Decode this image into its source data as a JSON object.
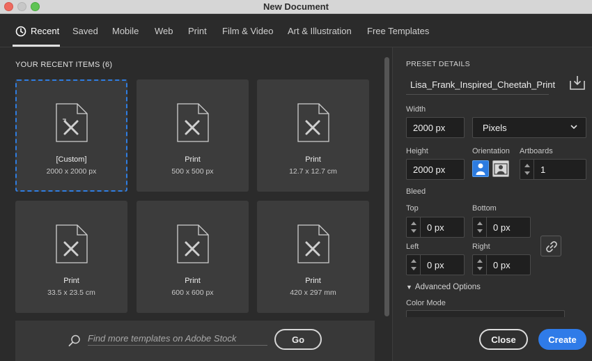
{
  "window": {
    "title": "New Document"
  },
  "tabs": [
    {
      "label": "Recent",
      "active": true
    },
    {
      "label": "Saved"
    },
    {
      "label": "Mobile"
    },
    {
      "label": "Web"
    },
    {
      "label": "Print"
    },
    {
      "label": "Film & Video"
    },
    {
      "label": "Art & Illustration"
    },
    {
      "label": "Free Templates"
    }
  ],
  "recent": {
    "heading": "YOUR RECENT ITEMS",
    "count": "(6)",
    "items": [
      {
        "title": "[Custom]",
        "size": "2000 x 2000 px",
        "selected": true
      },
      {
        "title": "Print",
        "size": "500 x 500 px"
      },
      {
        "title": "Print",
        "size": "12.7 x 12.7 cm"
      },
      {
        "title": "Print",
        "size": "33.5 x 23.5 cm"
      },
      {
        "title": "Print",
        "size": "600 x 600 px"
      },
      {
        "title": "Print",
        "size": "420 x 297 mm"
      }
    ]
  },
  "stock": {
    "placeholder": "Find more templates on Adobe Stock",
    "go_label": "Go"
  },
  "preset": {
    "heading": "PRESET DETAILS",
    "name": "Lisa_Frank_Inspired_Cheetah_Print",
    "width_label": "Width",
    "width_value": "2000 px",
    "units": "Pixels",
    "height_label": "Height",
    "height_value": "2000 px",
    "orientation_label": "Orientation",
    "artboards_label": "Artboards",
    "artboards_value": "1",
    "bleed_label": "Bleed",
    "top_label": "Top",
    "top_value": "0 px",
    "bottom_label": "Bottom",
    "bottom_value": "0 px",
    "left_label": "Left",
    "left_value": "0 px",
    "right_label": "Right",
    "right_value": "0 px",
    "advanced_label": "Advanced Options",
    "color_mode_label": "Color Mode"
  },
  "actions": {
    "close_label": "Close",
    "create_label": "Create"
  },
  "colors": {
    "accent": "#2f7be8",
    "selection": "#2f7de1"
  }
}
